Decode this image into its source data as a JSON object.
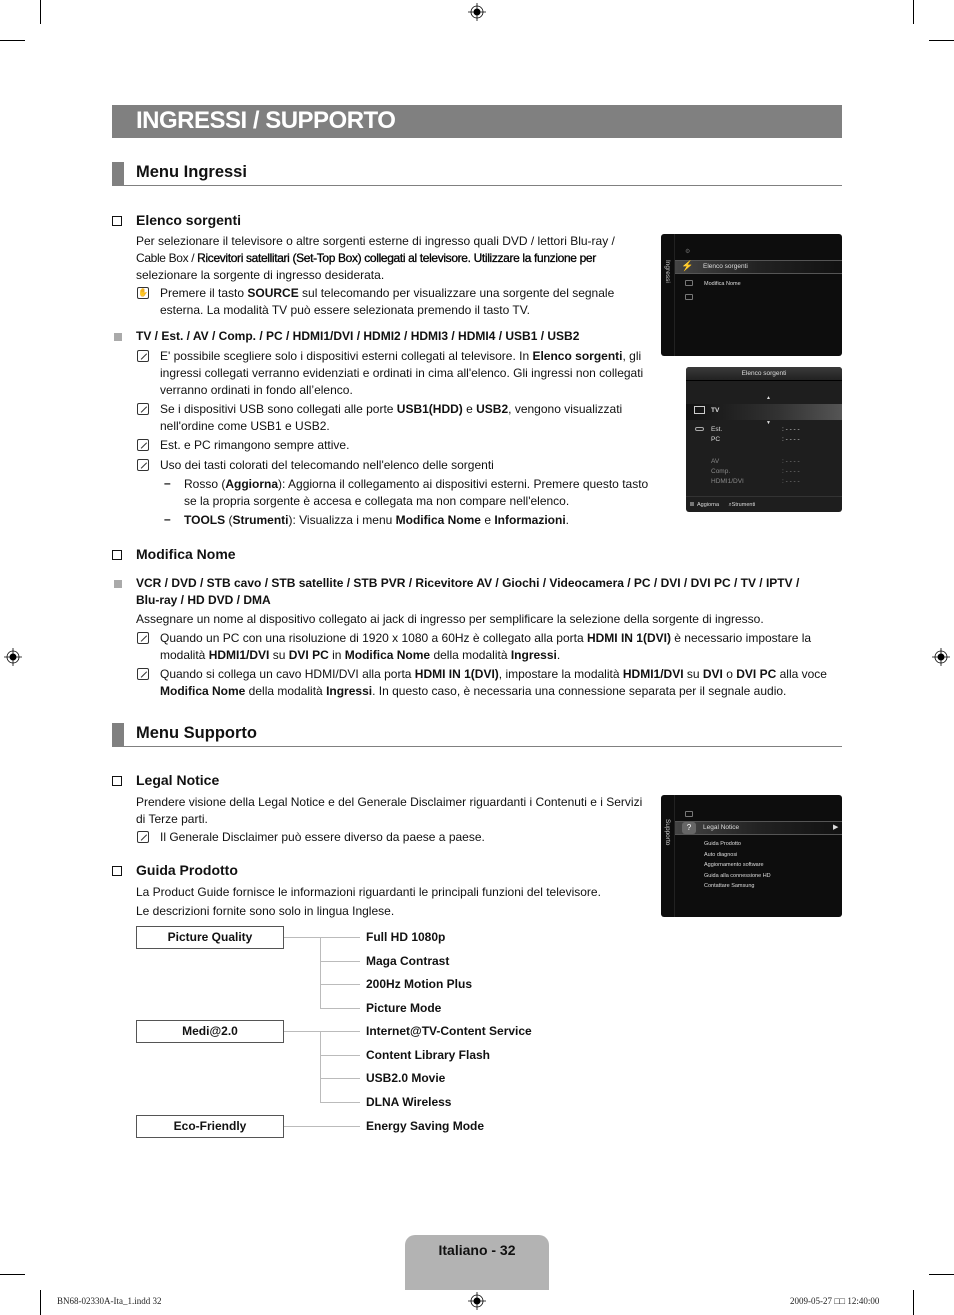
{
  "page": {
    "title": "INGRESSI / SUPPORTO",
    "footer_label": "Italiano - 32",
    "slug_left": "BN68-02330A-Ita_1.indd   32",
    "slug_right": "2009-05-27   □□ 12:40:00"
  },
  "menu_ingressi": {
    "heading": "Menu Ingressi",
    "elenco": {
      "heading": "Elenco sorgenti",
      "intro_l1": "Per selezionare il televisore o altre sorgenti esterne di ingresso quali DVD / lettori Blu-ray /",
      "intro_l2a": "Cable Box / ",
      "intro_l2b": "Ricevitori satellitari (Set-Top Box) collegati al televisore. Utilizzare la funzione per",
      "intro_l3": "selezionare la sorgente di ingresso desiderata.",
      "remote_note_l1a": "Premere il tasto ",
      "remote_note_l1b": "SOURCE",
      "remote_note_l1c": " sul telecomando per visualizzare una sorgente del segnale",
      "remote_note_l2": "esterna. La modalità TV può essere selezionata premendo il tasto TV.",
      "sources_line": "TV / Est. / AV / Comp. / PC / HDMI1/DVI / HDMI2 / HDMI3 / HDMI4 / USB1 / USB2",
      "note1_l1a": "E' possibile scegliere solo i dispositivi esterni collegati al televisore. In ",
      "note1_l1b": "Elenco sorgenti",
      "note1_l1c": ", gli",
      "note1_l2": "ingressi collegati verranno evidenziati e ordinati in cima all'elenco. Gli ingressi non collegati",
      "note1_l3": "verranno ordinati in fondo all’elenco.",
      "note2_l1a": "Se i dispositivi USB sono collegati alle porte ",
      "note2_l1b": "USB1(HDD)",
      "note2_l1c": " e ",
      "note2_l1d": "USB2",
      "note2_l1e": ", vengono visualizzati",
      "note2_l2": "nell'ordine come USB1 e USB2.",
      "note3": "Est. e PC rimangono sempre attive.",
      "note4": "Uso dei tasti colorati del telecomando nell'elenco delle sorgenti",
      "dash1_l1a": "Rosso (",
      "dash1_l1b": "Aggiorna",
      "dash1_l1c": "): Aggiorna il collegamento ai dispositivi esterni. Premere questo tasto",
      "dash1_l2": "se la propria sorgente è accesa e collegata ma non compare nell'elenco.",
      "dash2_a": "TOOLS",
      "dash2_b": " (",
      "dash2_c": "Strumenti",
      "dash2_d": "): Visualizza i menu ",
      "dash2_e": "Modifica Nome",
      "dash2_f": " e ",
      "dash2_g": "Informazioni",
      "dash2_h": "."
    },
    "modifica": {
      "heading": "Modifica Nome",
      "names_l1": "VCR / DVD / STB cavo / STB satellite / STB PVR / Ricevitore AV / Giochi / Videocamera / PC / DVI / DVI PC / TV / IPTV /",
      "names_l2": "Blu-ray / HD DVD / DMA",
      "desc": "Assegnare un nome al dispositivo collegato ai jack di ingresso per semplificare la selezione della sorgente di ingresso.",
      "n1_l1a": "Quando un PC con una risoluzione di 1920 x 1080 a 60Hz è collegato alla porta ",
      "n1_l1b": "HDMI IN 1(DVI)",
      "n1_l1c": " è necessario impostare la",
      "n1_l2a": "modalità ",
      "n1_l2b": "HDMI1/DVI",
      "n1_l2c": " su ",
      "n1_l2d": "DVI PC",
      "n1_l2e": " in ",
      "n1_l2f": "Modifica Nome",
      "n1_l2g": " della modalità ",
      "n1_l2h": "Ingressi",
      "n1_l2i": ".",
      "n2_l1a": "Quando si collega un cavo HDMI/DVI alla porta ",
      "n2_l1b": "HDMI IN 1(DVI)",
      "n2_l1c": ", impostare la modalità ",
      "n2_l1d": "HDMI1/DVI",
      "n2_l1e": " su ",
      "n2_l1f": "DVI",
      "n2_l1g": " o ",
      "n2_l1h": "DVI PC",
      "n2_l1i": " alla voce",
      "n2_l2a": "Modifica Nome",
      "n2_l2b": " della modalità ",
      "n2_l2c": "Ingressi",
      "n2_l2d": ". In questo caso, è necessaria una connessione separata per il segnale audio."
    }
  },
  "menu_supporto": {
    "heading": "Menu Supporto",
    "legal": {
      "heading": "Legal Notice",
      "l1": "Prendere visione della Legal Notice e del Generale Disclaimer riguardanti i Contenuti e i Servizi",
      "l2": "di Terze parti.",
      "note": "Il Generale Disclaimer può essere diverso da paese a paese."
    },
    "guida": {
      "heading": "Guida Prodotto",
      "l1": "La Product Guide fornisce le informazioni riguardanti le principali funzioni del televisore.",
      "l2": "Le descrizioni fornite sono solo in lingua Inglese."
    }
  },
  "features": [
    {
      "category": "Picture Quality",
      "items": [
        "Full HD 1080p",
        "Maga Contrast",
        "200Hz Motion Plus",
        "Picture Mode"
      ]
    },
    {
      "category": "Medi@2.0",
      "items": [
        "Internet@TV-Content Service",
        "Content Library Flash",
        "USB2.0 Movie",
        "DLNA Wireless"
      ]
    },
    {
      "category": "Eco-Friendly",
      "items": [
        "Energy Saving Mode"
      ]
    }
  ],
  "tv_ingressi": {
    "side_label": "Ingressi",
    "items": [
      "Elenco sorgenti",
      "Modifica Nome"
    ]
  },
  "tv_sources": {
    "title": "Elenco sorgenti",
    "selected": "TV",
    "rows": [
      {
        "name": "Est.",
        "value": ": - - - -"
      },
      {
        "name": "PC",
        "value": ": - - - -"
      },
      {
        "name": "AV",
        "value": ": - - - -"
      },
      {
        "name": "Comp.",
        "value": ": - - - -"
      },
      {
        "name": "HDMI1/DVI",
        "value": ": - - - -"
      }
    ],
    "footer_refresh": "Aggiorna",
    "footer_tools": "Strumenti"
  },
  "tv_supporto": {
    "side_label": "Supporto",
    "selected": "Legal Notice",
    "items": [
      "Guida Prodotto",
      "Auto diagnosi",
      "Aggiornamento software",
      "Guida alla connessione HD",
      "Contattare Samsung"
    ]
  }
}
